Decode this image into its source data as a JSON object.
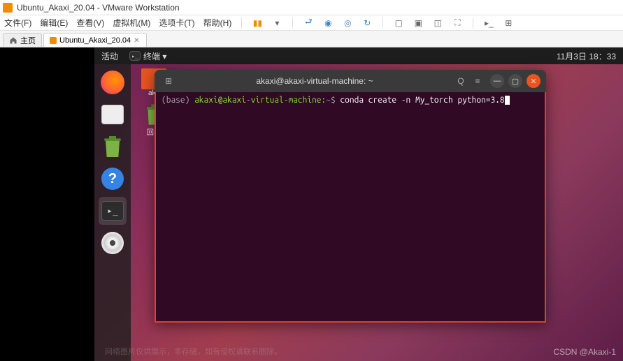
{
  "vmware": {
    "title": "Ubuntu_Akaxi_20.04 - VMware Workstation",
    "menu": [
      "文件(F)",
      "编辑(E)",
      "查看(V)",
      "虚拟机(M)",
      "选项卡(T)",
      "帮助(H)"
    ],
    "tabs": {
      "home": "主页",
      "vm": "Ubuntu_Akaxi_20.04"
    }
  },
  "ubuntu": {
    "activities": "活动",
    "app_indicator": "终端 ▾",
    "clock": "11月3日 18：33",
    "desktop_icons": {
      "folder": "aka",
      "trash": "回收"
    }
  },
  "terminal": {
    "title": "akaxi@akaxi-virtual-machine: ~",
    "prompt_env": "(base)",
    "prompt_userhost": "akaxi@akaxi-virtual-machine",
    "prompt_sep": ":",
    "prompt_path": "~",
    "prompt_symbol": "$",
    "command": "conda create -n My_torch python=3.8"
  },
  "watermark": "CSDN @Akaxi-1",
  "faint": "网络图片仅供展示，非存储，如有侵权请联系删除。"
}
